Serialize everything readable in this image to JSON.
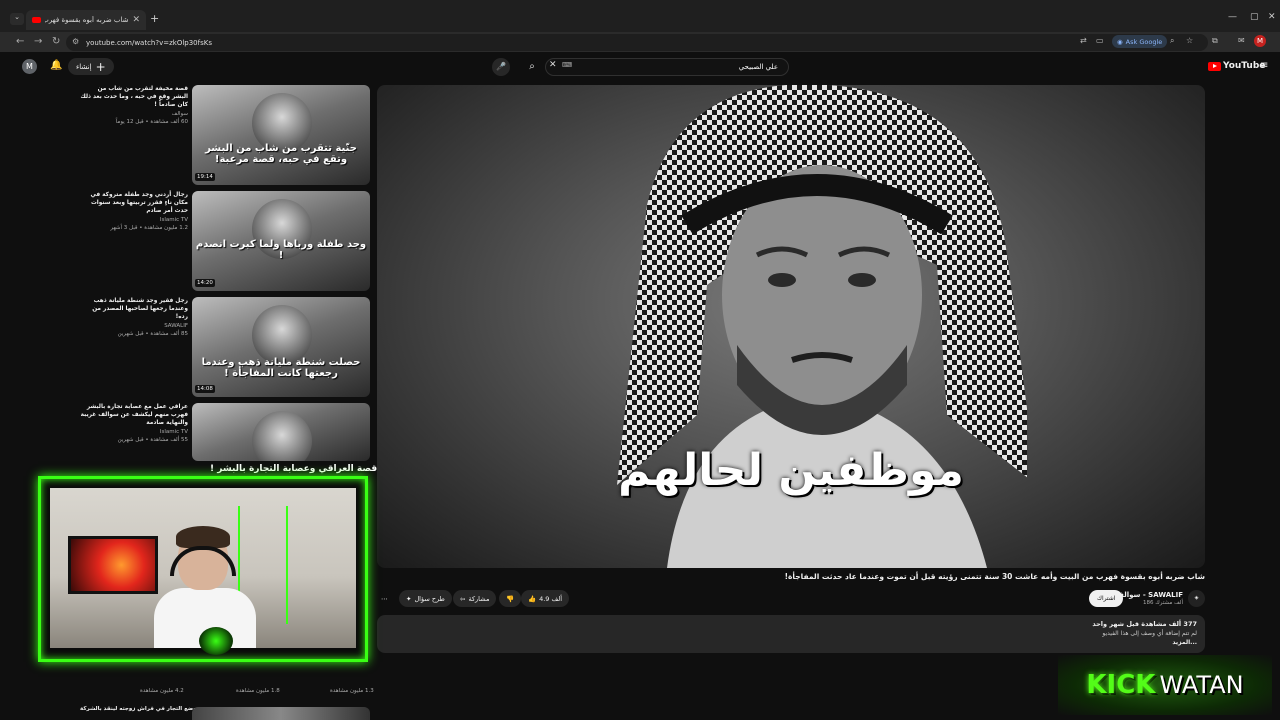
{
  "browser": {
    "tab_title": "شاب ضربه أبوه بقسوة فهرب",
    "url": "youtube.com/watch?v=zkOlp30fsKs",
    "ask_google": "Ask Google",
    "profile_initial": "M"
  },
  "header": {
    "avatar_initial": "M",
    "create_label": "إنشاء",
    "search_value": "علي الصبيحي",
    "logo_text": "YouTube"
  },
  "player": {
    "overlay_caption": "موظفين لحالهم"
  },
  "video": {
    "title": "شاب ضربه أبوه بقسوة فهرب من البيت وأمه عاشت 30 سنة تتمنى رؤيته قبل أن تموت وعندما عاد حدثت المفاجأة!",
    "like_count": "4.9 ألف",
    "share_label": "مشاركة",
    "ask_label": "طرح سؤال",
    "channel_name": "سوالف - SAWALIF",
    "channel_subs": "186 ألف مشترك",
    "subscribe_label": "اشتراك",
    "description": {
      "views": "377 ألف مشاهدة قبل شهر واحد",
      "text": "لم تتم إضافة أي وصف إلى هذا الفيديو",
      "more": "...المزيد"
    }
  },
  "sidebar": {
    "items": [
      {
        "title": "قصة مخيفة لتقرب من شاب من البشر وقع في حبه ، وما حدث بعد ذلك كان صادماً !",
        "channel": "سوالف",
        "stats": "60 ألف مشاهدة • قبل 12 يوماً",
        "duration": "19:14",
        "caption": "جنّية تتقرب من شاب من البشر وتقع في حبه، قصة مرعبة!"
      },
      {
        "title": "رجال أردني وجد طفلة متروكة في مكان ناءٍ فقرر تربيتها وبعد سنوات حدث أمر صادم",
        "channel": "Islamic TV",
        "stats": "1.2 مليون مشاهدة • قبل 3 أشهر",
        "duration": "14:20",
        "caption": "وجد طفلة ورباها ولما كبرت انصدم !"
      },
      {
        "title": "رجل فقير وجد شنطة مليانة ذهب وعندما رجعها لصاحبها المصدر من رده!",
        "channel": "SAWALIF",
        "stats": "85 ألف مشاهدة • قبل شهرين",
        "duration": "14:08",
        "caption": "حصلت شنطة مليانة ذهب وعندما رجعتها كانت المفاجأة !"
      },
      {
        "title": "عراقي عمل مع عصابة تجارة بالبشر فهرب منهم ليكشف عن سوالف غريبة والنهاية صادمة",
        "channel": "Islamic TV",
        "stats": "55 ألف مشاهدة • قبل شهرين",
        "duration": "",
        "caption": "قصة العراقي وعصابة التجارة بالبشر !"
      }
    ],
    "bottom_stats": [
      "4.2 مليون مشاهدة",
      "1.8 مليون مشاهدة",
      "1.3 مليون مشاهدة"
    ],
    "bottom_title": "وضع التجار في فراش زوجته لينقذ بالشركة"
  },
  "overlay": {
    "kick_word": "KICK",
    "watan_word": "WATAN"
  },
  "colors": {
    "accent_green": "#39ff14",
    "kick_green": "#53fc18",
    "youtube_red": "#ff0000"
  }
}
